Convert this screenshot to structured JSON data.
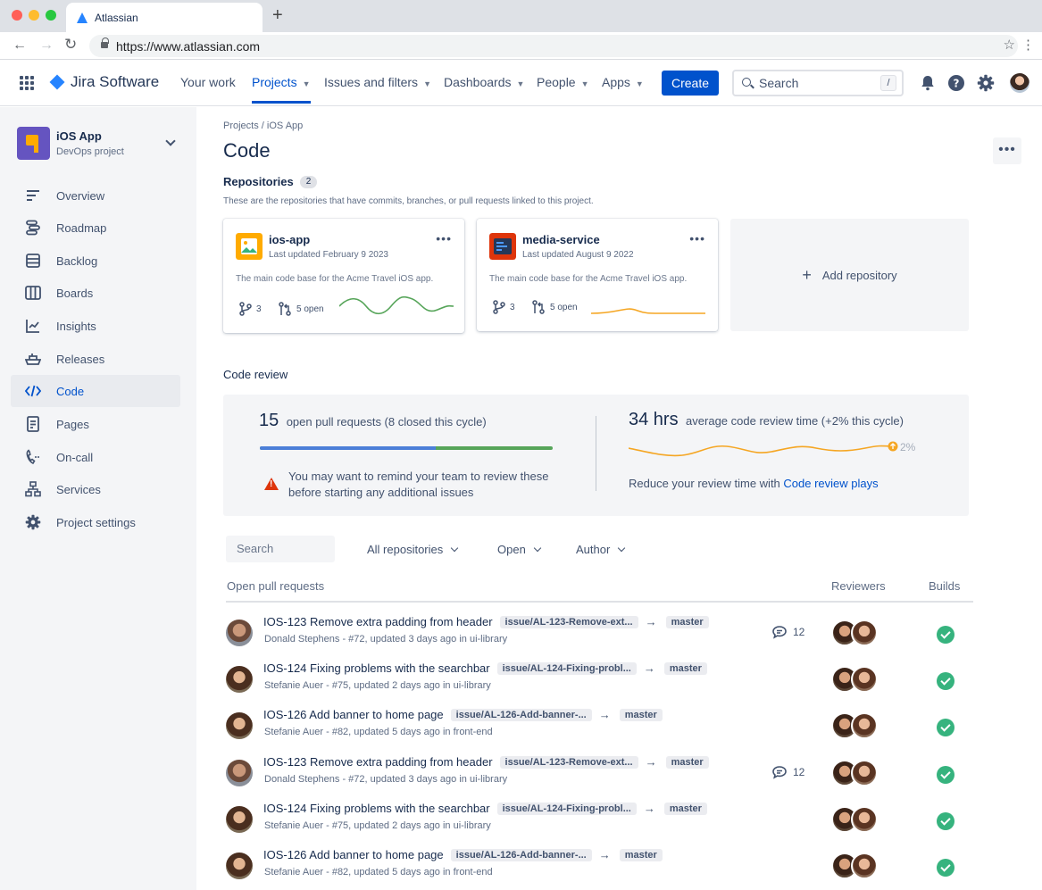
{
  "browser": {
    "tab_title": "Atlassian",
    "new_tab": "+",
    "url_prefix": "https://www.",
    "url_domain": "atlassian.com"
  },
  "topnav": {
    "product": "Jira Software",
    "items": [
      "Your work",
      "Projects",
      "Issues and filters",
      "Dashboards",
      "People",
      "Apps"
    ],
    "create_label": "Create",
    "search_placeholder": "Search",
    "search_shortcut": "/"
  },
  "sidebar": {
    "project_name": "iOS App",
    "project_type": "DevOps project",
    "items": [
      {
        "label": "Overview",
        "icon": "overview-icon"
      },
      {
        "label": "Roadmap",
        "icon": "roadmap-icon"
      },
      {
        "label": "Backlog",
        "icon": "backlog-icon"
      },
      {
        "label": "Boards",
        "icon": "boards-icon"
      },
      {
        "label": "Insights",
        "icon": "insights-icon"
      },
      {
        "label": "Releases",
        "icon": "releases-icon"
      },
      {
        "label": "Code",
        "icon": "code-icon",
        "active": true
      },
      {
        "label": "Pages",
        "icon": "pages-icon"
      },
      {
        "label": "On-call",
        "icon": "on-call-icon"
      },
      {
        "label": "Services",
        "icon": "services-icon"
      },
      {
        "label": "Project settings",
        "icon": "settings-icon"
      }
    ]
  },
  "main": {
    "breadcrumb": "Projects / iOS App",
    "title": "Code",
    "more": "•••",
    "repositories": {
      "heading": "Repositories",
      "count": "2",
      "description": "These are the repositories that have commits, branches, or pull requests linked to this project.",
      "cards": [
        {
          "name": "ios-app",
          "updated": "Last updated February 9 2023",
          "description": "The main code base for the Acme Travel iOS app.",
          "branches": "3",
          "prs": "5 open",
          "sparkline_color": "#57a55a"
        },
        {
          "name": "media-service",
          "updated": "Last updated August 9 2022",
          "description": "The main code base for the Acme Travel iOS app.",
          "branches": "3",
          "prs": "5 open",
          "sparkline_color": "#f5a623"
        }
      ],
      "add_label": "Add repository"
    },
    "code_review": {
      "heading": "Code review",
      "open_count": "15",
      "open_text": "open pull requests (8 closed this cycle)",
      "progress_blue_fraction": 0.6,
      "warning": "You may want to remind your team to review these before starting any additional issues",
      "avg_time": "34 hrs",
      "avg_text": "average code review time (+2% this cycle)",
      "trend_label": "2%",
      "reduce_text": "Reduce your review time with ",
      "reduce_link": "Code review plays"
    },
    "filters": {
      "search_placeholder": "Search",
      "repositories": "All repositories",
      "status": "Open",
      "author": "Author"
    },
    "table": {
      "heading": "Open pull requests",
      "reviewers_header": "Reviewers",
      "builds_header": "Builds",
      "rows": [
        {
          "title": "IOS-123 Remove extra padding from header",
          "branch": "issue/AL-123-Remove-ext...",
          "target": "master",
          "meta": "Donald Stephens - #72, updated 3 days ago in ui-library",
          "comments": "12",
          "author": "donald"
        },
        {
          "title": "IOS-124 Fixing problems with the searchbar",
          "branch": "issue/AL-124-Fixing-probl...",
          "target": "master",
          "meta": "Stefanie Auer - #75, updated 2 days ago in ui-library",
          "comments": "",
          "author": "stefanie"
        },
        {
          "title": "IOS-126 Add banner to home page",
          "branch": "issue/AL-126-Add-banner-...",
          "target": "master",
          "meta": "Stefanie Auer - #82, updated 5 days ago in front-end",
          "comments": "",
          "author": "stefanie"
        },
        {
          "title": "IOS-123 Remove extra padding from header",
          "branch": "issue/AL-123-Remove-ext...",
          "target": "master",
          "meta": "Donald Stephens - #72, updated 3 days ago in ui-library",
          "comments": "12",
          "author": "donald"
        },
        {
          "title": "IOS-124 Fixing problems with the searchbar",
          "branch": "issue/AL-124-Fixing-probl...",
          "target": "master",
          "meta": "Stefanie Auer - #75, updated 2 days ago in ui-library",
          "comments": "",
          "author": "stefanie"
        },
        {
          "title": "IOS-126 Add banner to home page",
          "branch": "issue/AL-126-Add-banner-...",
          "target": "master",
          "meta": "Stefanie Auer - #82, updated 5 days ago in front-end",
          "comments": "",
          "author": "stefanie"
        }
      ]
    }
  }
}
